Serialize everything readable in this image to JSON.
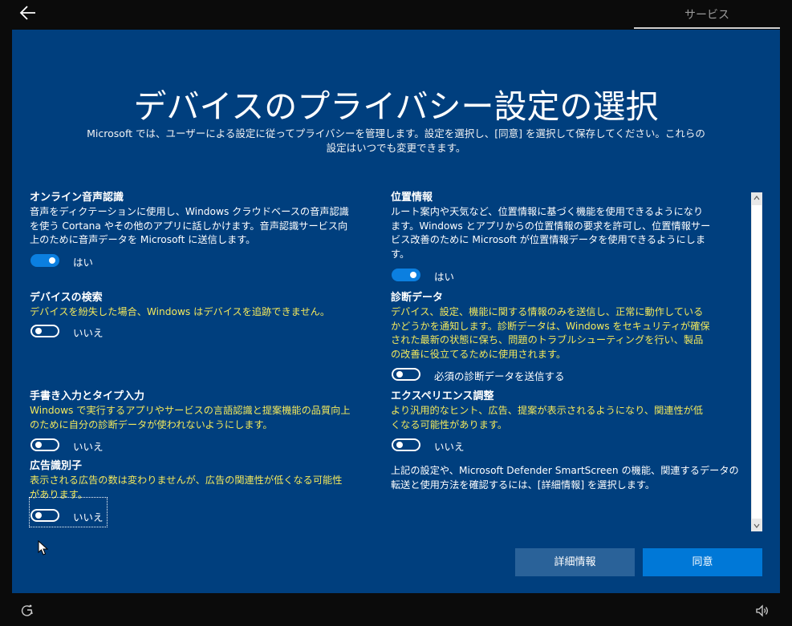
{
  "header": {
    "tab_label": "サービス"
  },
  "page": {
    "title": "デバイスのプライバシー設定の選択",
    "subtitle_line1": "Microsoft では、ユーザーによる設定に従ってプライバシーを管理します。設定を選択し、[同意] を選択して保存してください。これらの",
    "subtitle_line2": "設定はいつでも変更できます。"
  },
  "left_column": {
    "online_speech": {
      "title": "オンライン音声認識",
      "desc": [
        "音声をディクテーションに使用し、Windows クラウドベースの音声認識",
        "を使う Cortana やその他のアプリに話しかけます。音声認識サービス向",
        "上のために音声データを Microsoft に送信します。"
      ],
      "toggle_label": "はい"
    },
    "find_device": {
      "title": "デバイスの検索",
      "desc": [
        "デバイスを紛失した場合、Windows はデバイスを追跡できません。"
      ],
      "toggle_label": "いいえ"
    },
    "inking_typing": {
      "title": "手書き入力とタイプ入力",
      "desc": [
        "Windows で実行するアプリやサービスの言語認識と提案機能の品質向上",
        "のために自分の診断データが使われないようにします。"
      ],
      "toggle_label": "いいえ"
    },
    "advertising_id": {
      "title": "広告識別子",
      "desc": [
        "表示される広告の数は変わりませんが、広告の関連性が低くなる可能性",
        "があります。"
      ],
      "toggle_label": "いいえ"
    }
  },
  "right_column": {
    "location": {
      "title": "位置情報",
      "desc": [
        "ルート案内や天気など、位置情報に基づく機能を使用できるようになり",
        "ます。Windows とアプリからの位置情報の要求を許可し、位置情報サー",
        "ビス改善のために Microsoft が位置情報データを使用できるようにしま",
        "す。"
      ],
      "toggle_label": "はい"
    },
    "diagnostics": {
      "title": "診断データ",
      "desc": [
        "デバイス、設定、機能に関する情報のみを送信し、正常に動作している",
        "かどうかを通知します。診断データは、Windows をセキュリティが確保",
        "された最新の状態に保ち、問題のトラブルシューティングを行い、製品",
        "の改善に役立てるために使用されます。"
      ],
      "toggle_label": "必須の診断データを送信する"
    },
    "tailored_experiences": {
      "title": "エクスペリエンス調整",
      "desc": [
        "より汎用的なヒント、広告、提案が表示されるようになり、関連性が低",
        "くなる可能性があります。"
      ],
      "toggle_label": "いいえ"
    },
    "footer_note": [
      "上記の設定や、Microsoft Defender SmartScreen の機能、関連するデータの",
      "転送と使用方法を確認するには、[詳細情報] を選択します。"
    ]
  },
  "buttons": {
    "details": "詳細情報",
    "agree": "同意"
  },
  "colors": {
    "panel_bg": "#003f7e",
    "toggle_on": "#0b7fe0",
    "highlight_text": "#f2e85c",
    "agree_button": "#0078d7",
    "details_button": "#2a6299"
  },
  "icons": {
    "back": "back-arrow-icon",
    "accessibility": "ease-of-access-icon",
    "volume": "volume-icon"
  }
}
